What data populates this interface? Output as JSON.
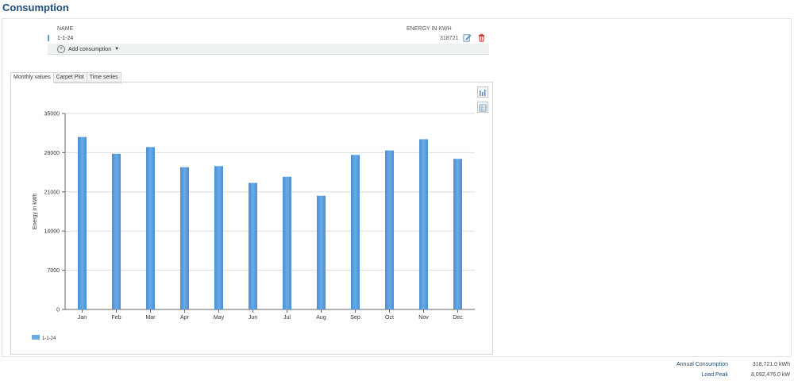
{
  "page": {
    "title": "Consumption"
  },
  "table": {
    "headers": {
      "name": "NAME",
      "energy": "ENERGY IN KWH"
    },
    "rows": [
      {
        "name": "1-1-24",
        "energy": "318721"
      }
    ],
    "add_label": "Add consumption"
  },
  "tabs": [
    "Monthly values",
    "Carpet Plot",
    "Time series"
  ],
  "chart_data": {
    "type": "bar",
    "categories": [
      "Jan",
      "Feb",
      "Mar",
      "Apr",
      "May",
      "Jun",
      "Jul",
      "Aug",
      "Sep",
      "Oct",
      "Nov",
      "Dec"
    ],
    "series": [
      {
        "name": "1-1-24",
        "values": [
          30800,
          27800,
          29000,
          25400,
          25600,
          22600,
          23700,
          20300,
          27600,
          28400,
          30400,
          26900
        ]
      }
    ],
    "ylabel": "Energy in kWh",
    "xlabel": "",
    "ylim": [
      0,
      35000
    ],
    "yticks": [
      0,
      7000,
      14000,
      21000,
      28000,
      35000
    ],
    "grid": true,
    "legend_position": "bottom-left",
    "color": "#6aaae4"
  },
  "summary": {
    "annual_label": "Annual Consumption",
    "annual_value": "318,721.0 kWh",
    "peak_label": "Load Peak",
    "peak_value": "8,092,476.0 kW"
  },
  "icons": [
    "edit-icon",
    "delete-icon",
    "plus-icon",
    "chevron-down-icon",
    "chart-settings-icon",
    "chart-table-icon"
  ]
}
